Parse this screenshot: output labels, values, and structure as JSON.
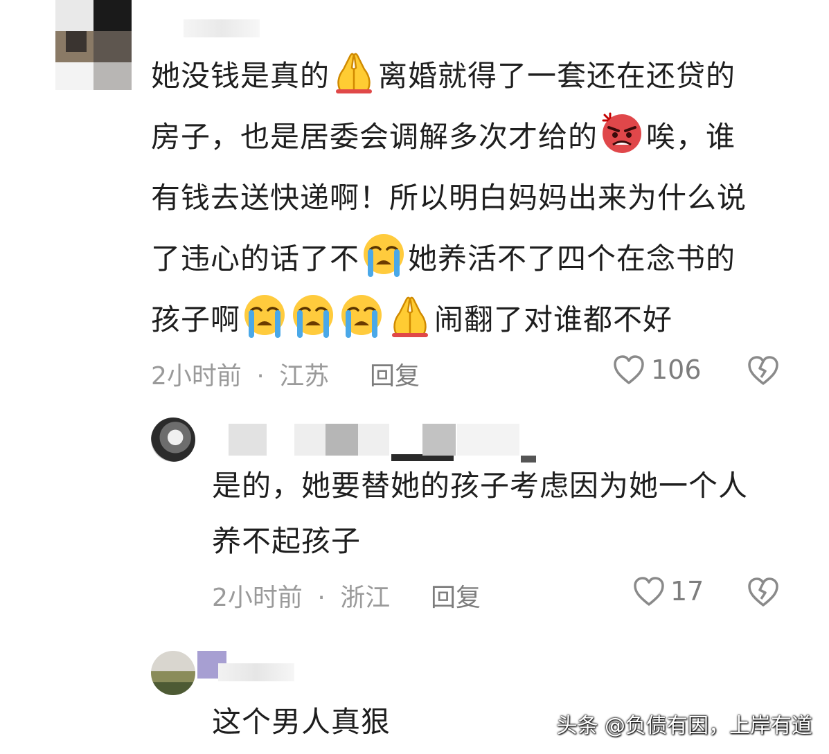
{
  "comments": [
    {
      "text_lines": [
        [
          "她没钱是真的",
          "{pray}",
          "离婚就得了一套还在还贷的"
        ],
        [
          "房子，也是居委会调解多次才给的",
          "{angry}",
          "唉，谁"
        ],
        [
          "有钱去送快递啊！所以明白妈妈出来为什么说"
        ],
        [
          "了违心的话了不",
          "{cry}",
          "她养活不了四个在念书的"
        ],
        [
          "孩子啊",
          "{cry}",
          "{cry}",
          "{cry}",
          "{pray}",
          "闹翻了对谁都不好"
        ]
      ],
      "time": "2小时前",
      "location": "江苏",
      "reply_label": "回复",
      "likes": "106"
    },
    {
      "text_lines": [
        [
          "是的，她要替她的孩子考虑因为她一个人"
        ],
        [
          "养不起孩子"
        ]
      ],
      "time": "2小时前",
      "location": "浙江",
      "reply_label": "回复",
      "likes": "17"
    },
    {
      "text_lines": [
        [
          "这个男人真狠"
        ]
      ]
    }
  ],
  "meta_separator": "·",
  "watermark": "头条 @负债有因，上岸有道",
  "icons": {
    "like": "heart-outline-icon",
    "dislike": "broken-heart-icon",
    "emoji_pray": "folded-hands-emoji",
    "emoji_angry": "angry-face-emoji",
    "emoji_cry": "loudly-crying-face-emoji"
  }
}
